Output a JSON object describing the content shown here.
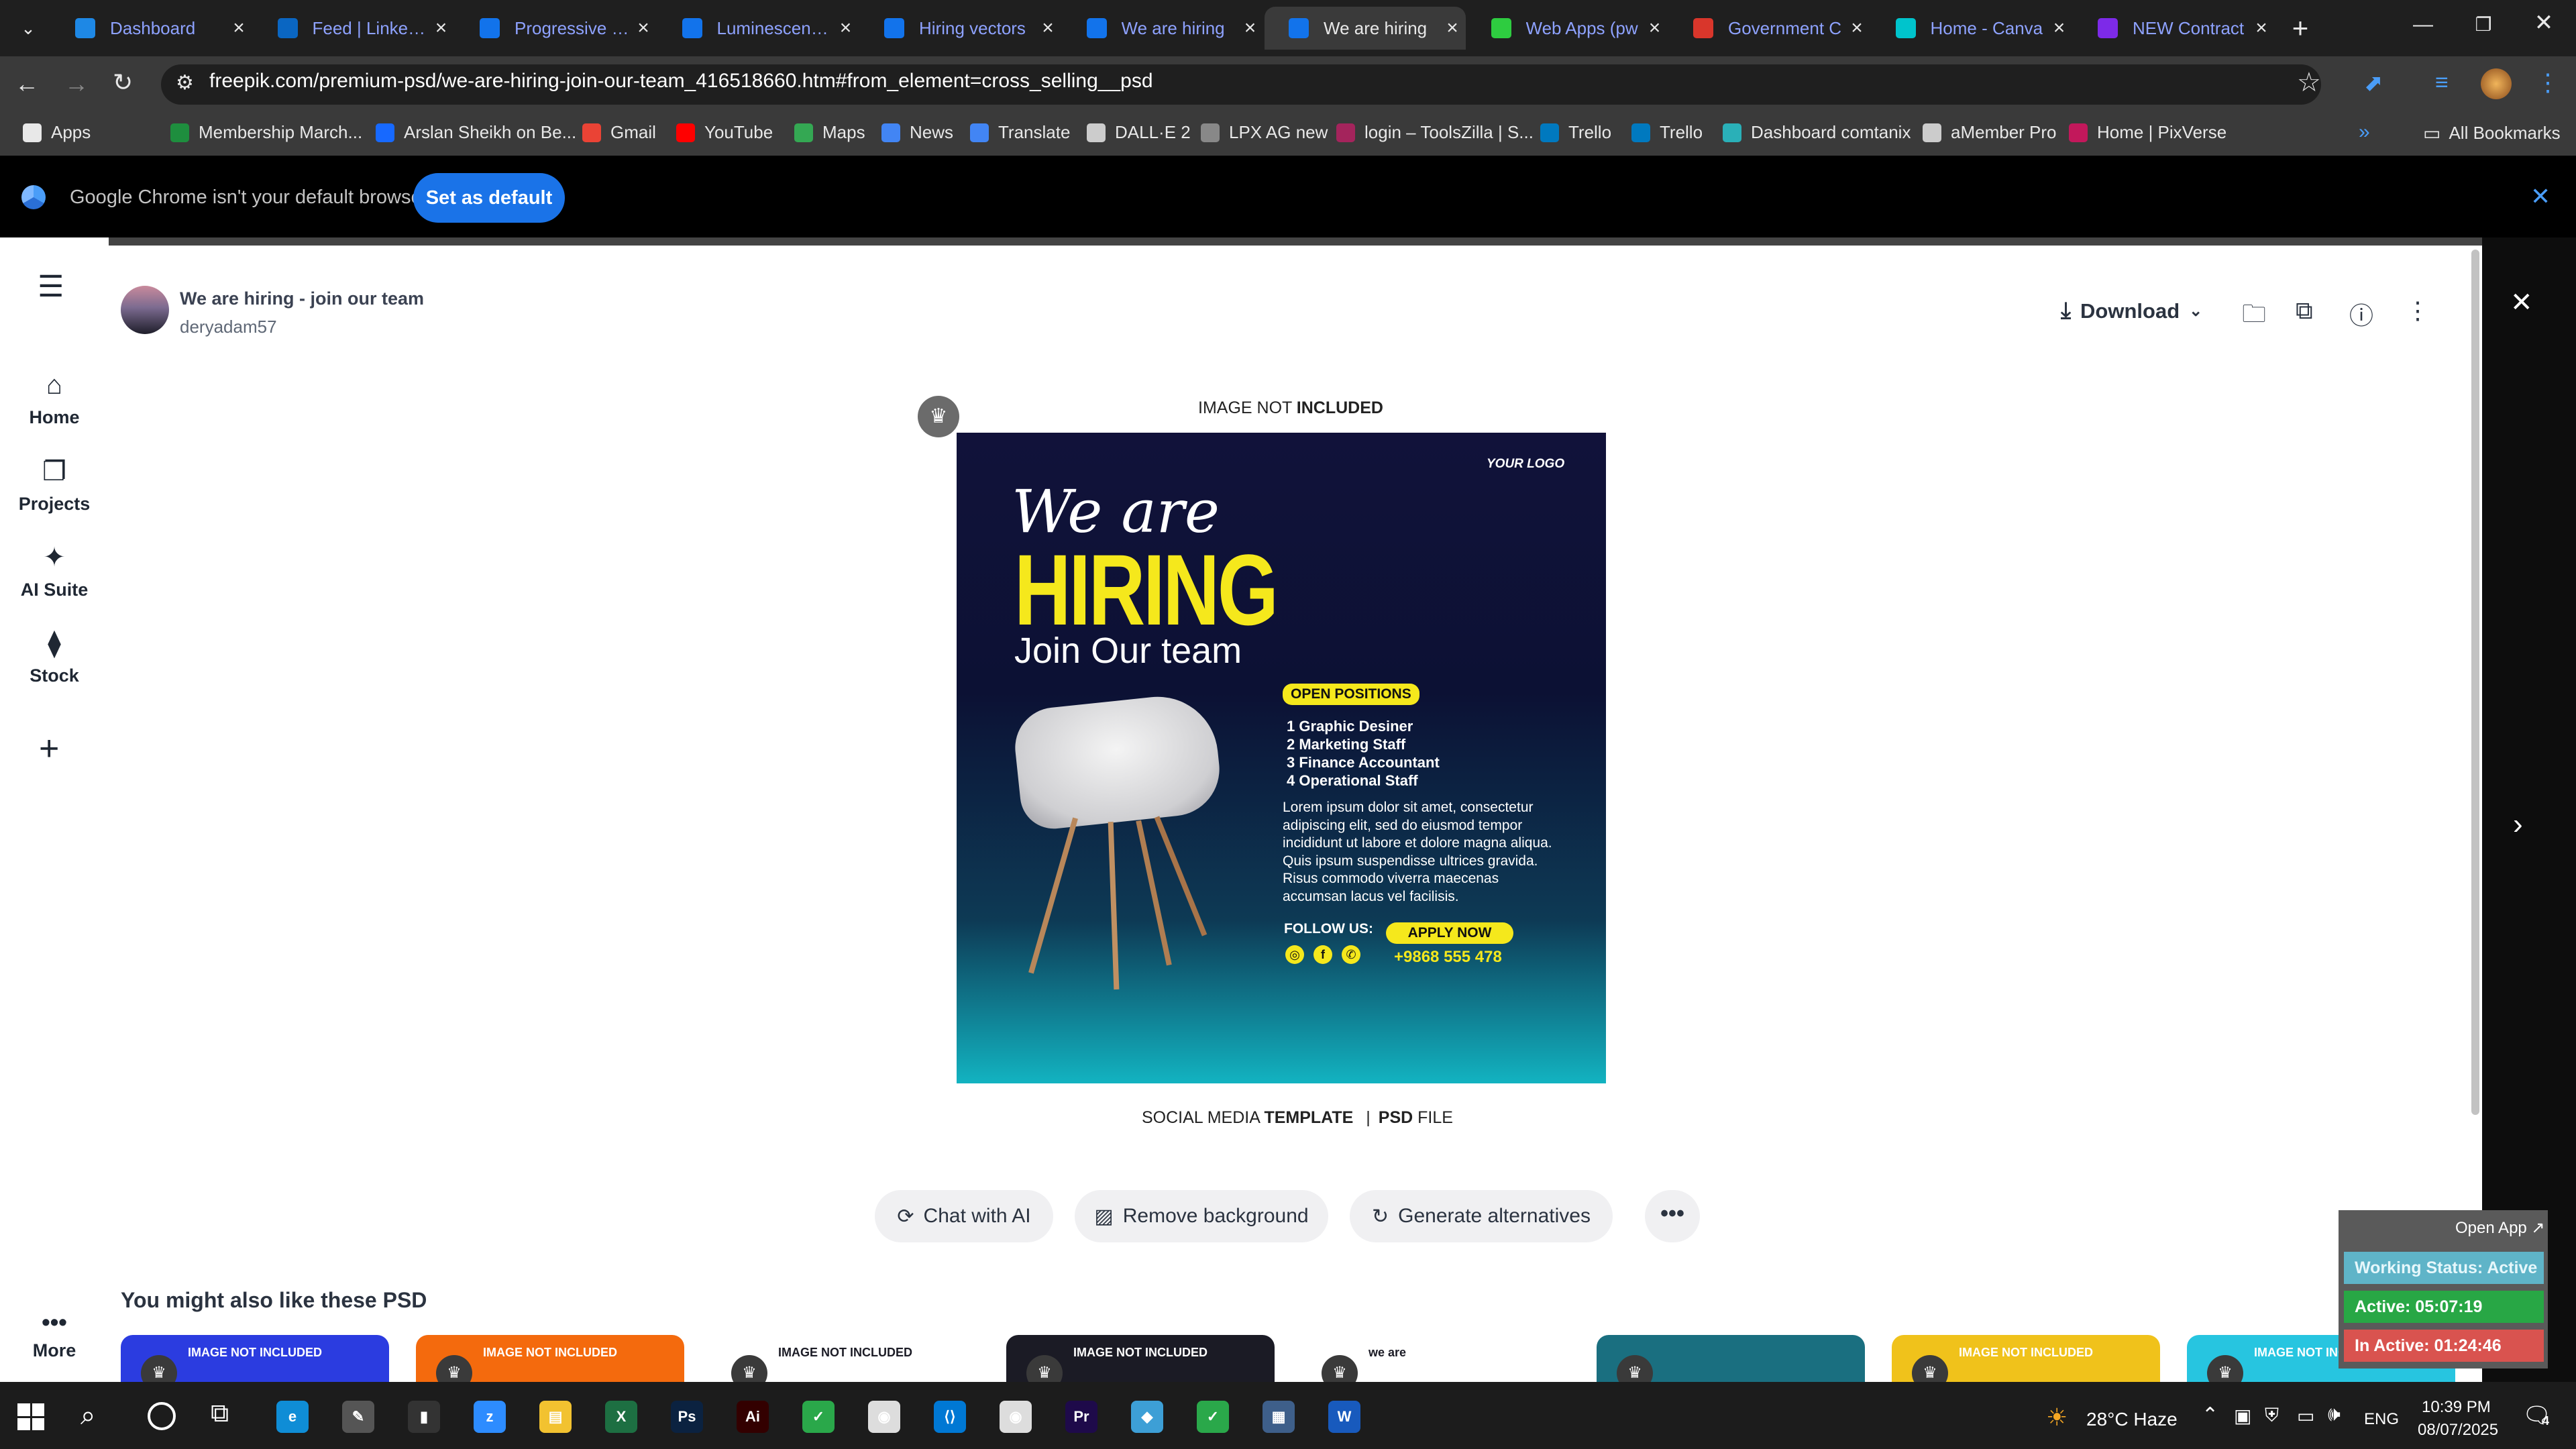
{
  "tabs": [
    {
      "title": "Dashboard",
      "favicon": "dashboard-icon",
      "color": "#1e88e5"
    },
    {
      "title": "Feed | LinkedIn",
      "favicon": "linkedin-icon",
      "color": "#0a66c2"
    },
    {
      "title": "Progressive we",
      "favicon": "freepik-icon",
      "color": "#1273eb"
    },
    {
      "title": "Luminescent te",
      "favicon": "freepik-icon",
      "color": "#1273eb"
    },
    {
      "title": "Hiring vectors",
      "favicon": "freepik-icon",
      "color": "#1273eb"
    },
    {
      "title": "We are hiring",
      "favicon": "freepik-icon",
      "color": "#1273eb"
    },
    {
      "title": "We are hiring",
      "favicon": "freepik-icon",
      "color": "#1273eb",
      "active": true
    },
    {
      "title": "Web Apps (pw",
      "favicon": "webapps-icon",
      "color": "#2ecc40"
    },
    {
      "title": "Government C",
      "favicon": "gov-icon",
      "color": "#d9362b"
    },
    {
      "title": "Home - Canva",
      "favicon": "canva-icon",
      "color": "#00c4cc"
    },
    {
      "title": "NEW Contract",
      "favicon": "canva-icon",
      "color": "#7d2ae8"
    }
  ],
  "address": {
    "url": "freepik.com/premium-psd/we-are-hiring-join-our-team_416518660.htm#from_element=cross_selling__psd"
  },
  "bookmarks": [
    {
      "label": "Apps",
      "color": "#e8e8e8"
    },
    {
      "label": "Membership March...",
      "color": "#1e8e3e"
    },
    {
      "label": "Arslan Sheikh on Be...",
      "color": "#1769ff"
    },
    {
      "label": "Gmail",
      "color": "#ea4335"
    },
    {
      "label": "YouTube",
      "color": "#ff0000"
    },
    {
      "label": "Maps",
      "color": "#34a853"
    },
    {
      "label": "News",
      "color": "#4285f4"
    },
    {
      "label": "Translate",
      "color": "#4285f4"
    },
    {
      "label": "DALL·E 2",
      "color": "#cccccc"
    },
    {
      "label": "LPX AG new",
      "color": "#888888"
    },
    {
      "label": "login – ToolsZilla | S...",
      "color": "#a4245c"
    },
    {
      "label": "Trello",
      "color": "#0079bf"
    },
    {
      "label": "Trello",
      "color": "#0079bf"
    },
    {
      "label": "Dashboard comtanix",
      "color": "#2ab0b8"
    },
    {
      "label": "aMember Pro",
      "color": "#cccccc"
    },
    {
      "label": "Home | PixVerse",
      "color": "#c2185b"
    }
  ],
  "all_bookmarks": "All Bookmarks",
  "banner": {
    "text": "Google Chrome isn't your default browser",
    "button": "Set as default"
  },
  "sidebar": [
    {
      "label": "Home",
      "icon": "home-icon"
    },
    {
      "label": "Projects",
      "icon": "projects-icon"
    },
    {
      "label": "AI Suite",
      "icon": "ai-suite-icon"
    },
    {
      "label": "Stock",
      "icon": "stock-icon"
    }
  ],
  "sidebar_more": "More",
  "asset": {
    "title": "We are hiring - join our team",
    "author": "deryadam57"
  },
  "actions": {
    "download": "Download"
  },
  "preview": {
    "top_label_a": "IMAGE NOT ",
    "top_label_b": "INCLUDED",
    "bottom_label_a": "SOCIAL MEDIA ",
    "bottom_label_b": "TEMPLATE",
    "bottom_sep": "|",
    "bottom_label_c": "PSD",
    "bottom_label_d": " FILE",
    "logo": "YOUR LOGO",
    "we_are": "We are",
    "hiring": "HIRING",
    "join": "Join Our team",
    "open_positions": "OPEN POSITIONS",
    "positions": [
      "1 Graphic Desiner",
      "2 Marketing Staff",
      "3 Finance Accountant",
      "4 Operational Staff"
    ],
    "lorem": [
      "Lorem ipsum dolor sit amet, consectetur",
      "adipiscing elit, sed do eiusmod tempor",
      "incididunt ut labore et dolore magna aliqua.",
      "Quis ipsum suspendisse ultrices gravida.",
      "Risus commodo viverra maecenas",
      "accumsan lacus vel facilisis."
    ],
    "follow": "FOLLOW US:",
    "apply": "APPLY NOW",
    "phone": "+9868 555 478"
  },
  "tools": {
    "chat": "Chat with AI",
    "remove_bg": "Remove background",
    "generate": "Generate alternatives"
  },
  "related": {
    "heading": "You might also like these PSD",
    "cards": [
      {
        "label": "IMAGE NOT INCLUDED",
        "color": "#2b3ce0"
      },
      {
        "label": "IMAGE NOT INCLUDED",
        "color": "#f46a0d"
      },
      {
        "label": "IMAGE NOT INCLUDED",
        "color": "#ffffff"
      },
      {
        "label": "IMAGE NOT INCLUDED",
        "color": "#1b1b25"
      },
      {
        "label": "we are",
        "color": "#ffffff"
      },
      {
        "label": "",
        "color": "#1a6f80"
      },
      {
        "label": "IMAGE NOT INCLUDED",
        "color": "#f0c21b"
      },
      {
        "label": "IMAGE NOT INCLUDED",
        "color": "#27c5e0"
      }
    ]
  },
  "tracker": {
    "open_app": "Open App ↗",
    "working": "Working Status: Active",
    "active": "Active: 05:07:19",
    "inactive": "In Active: 01:24:46"
  },
  "taskbar": {
    "weather": "28°C Haze",
    "lang": "ENG",
    "time": "10:39 PM",
    "date": "08/07/2025",
    "notifications": "4",
    "apps": [
      {
        "icon": "edge-icon",
        "color": "#0f8dd6"
      },
      {
        "icon": "pen-icon",
        "color": "#555555"
      },
      {
        "icon": "terminal-icon",
        "color": "#333333"
      },
      {
        "icon": "zoom-icon",
        "color": "#2d8cff"
      },
      {
        "icon": "file-explorer-icon",
        "color": "#f2c230"
      },
      {
        "icon": "excel-icon",
        "color": "#1d6f42"
      },
      {
        "icon": "photoshop-icon",
        "color": "#0b2240"
      },
      {
        "icon": "illustrator-icon",
        "color": "#330000"
      },
      {
        "icon": "greenapp-icon",
        "color": "#2aa84a"
      },
      {
        "icon": "chrome-icon",
        "color": "#dddddd"
      },
      {
        "icon": "vscode-icon",
        "color": "#0078d4"
      },
      {
        "icon": "chrome-icon",
        "color": "#dddddd"
      },
      {
        "icon": "premiere-icon",
        "color": "#1e0a4a"
      },
      {
        "icon": "app-icon",
        "color": "#3d9fd6"
      },
      {
        "icon": "greenapp-icon",
        "color": "#2aa84a"
      },
      {
        "icon": "calculator-icon",
        "color": "#3e5f8a"
      },
      {
        "icon": "word-icon",
        "color": "#185abd"
      }
    ]
  }
}
